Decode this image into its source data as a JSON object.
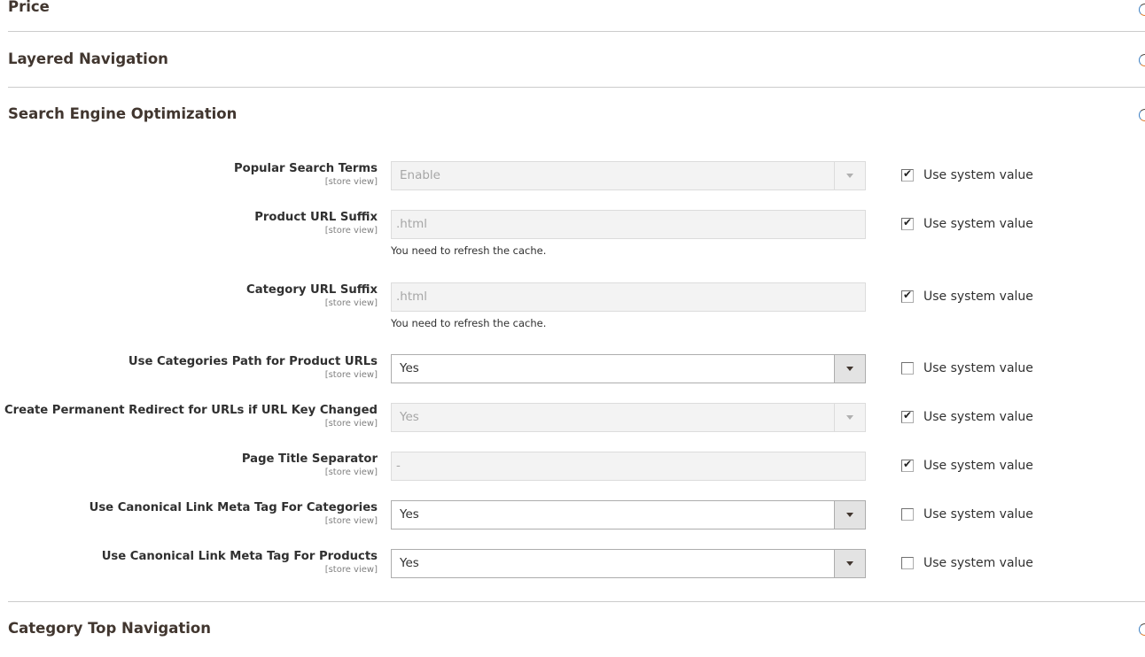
{
  "sections": {
    "price": {
      "title": "Price",
      "state": "collapsed"
    },
    "layered_navigation": {
      "title": "Layered Navigation",
      "state": "collapsed"
    },
    "seo": {
      "title": "Search Engine Optimization",
      "state": "expanded"
    },
    "category_top_navigation": {
      "title": "Category Top Navigation",
      "state": "collapsed"
    }
  },
  "seo_fields": [
    {
      "label": "Popular Search Terms",
      "scope": "[store view]",
      "type": "select",
      "value": "Enable",
      "disabled": true,
      "use_system_value": true,
      "use_system_label": "Use system value"
    },
    {
      "label": "Product URL Suffix",
      "scope": "[store view]",
      "type": "text",
      "value": ".html",
      "disabled": true,
      "note": "You need to refresh the cache.",
      "use_system_value": true,
      "use_system_label": "Use system value"
    },
    {
      "label": "Category URL Suffix",
      "scope": "[store view]",
      "type": "text",
      "value": ".html",
      "disabled": true,
      "note": "You need to refresh the cache.",
      "use_system_value": true,
      "use_system_label": "Use system value"
    },
    {
      "label": "Use Categories Path for Product URLs",
      "scope": "[store view]",
      "type": "select",
      "value": "Yes",
      "disabled": false,
      "use_system_value": false,
      "use_system_label": "Use system value"
    },
    {
      "label": "Create Permanent Redirect for URLs if URL Key Changed",
      "scope": "[store view]",
      "type": "select",
      "value": "Yes",
      "disabled": true,
      "use_system_value": true,
      "use_system_label": "Use system value"
    },
    {
      "label": "Page Title Separator",
      "scope": "[store view]",
      "type": "text",
      "value": "-",
      "disabled": true,
      "use_system_value": true,
      "use_system_label": "Use system value"
    },
    {
      "label": "Use Canonical Link Meta Tag For Categories",
      "scope": "[store view]",
      "type": "select",
      "value": "Yes",
      "disabled": false,
      "use_system_value": false,
      "use_system_label": "Use system value"
    },
    {
      "label": "Use Canonical Link Meta Tag For Products",
      "scope": "[store view]",
      "type": "select",
      "value": "Yes",
      "disabled": false,
      "use_system_value": false,
      "use_system_label": "Use system value"
    }
  ],
  "icons": {
    "check": "✔",
    "section_toggle": "circle-chevron-icon",
    "dropdown": "triangle-down"
  }
}
